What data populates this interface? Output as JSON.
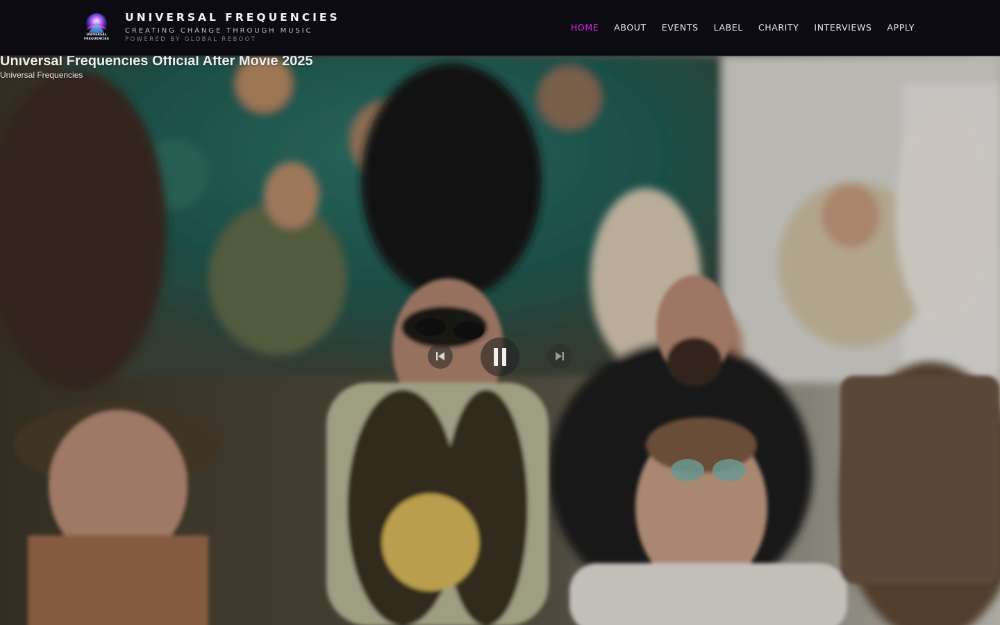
{
  "header": {
    "brand": {
      "title": "UNIVERSAL FREQUENCIES",
      "tagline": "CREATING CHANGE THROUGH MUSIC",
      "powered_by": "POWERED BY GLOBAL REBOOT",
      "logo_text": "UNIVERSAL FREQUENCIES"
    },
    "nav": [
      {
        "label": "HOME",
        "active": true
      },
      {
        "label": "ABOUT",
        "active": false
      },
      {
        "label": "EVENTS",
        "active": false
      },
      {
        "label": "LABEL",
        "active": false
      },
      {
        "label": "CHARITY",
        "active": false
      },
      {
        "label": "INTERVIEWS",
        "active": false
      },
      {
        "label": "APPLY",
        "active": false
      }
    ]
  },
  "video": {
    "title": "Universal Frequencies Official After Movie 2025",
    "channel": "Universal Frequencies",
    "controls": {
      "previous_icon": "skip-previous-icon",
      "play_state_icon": "pause-icon",
      "next_icon": "skip-next-icon"
    }
  },
  "colors": {
    "header_bg": "#0c0b12",
    "nav_active": "#e61ee6",
    "nav_text": "#e6e6ee"
  }
}
